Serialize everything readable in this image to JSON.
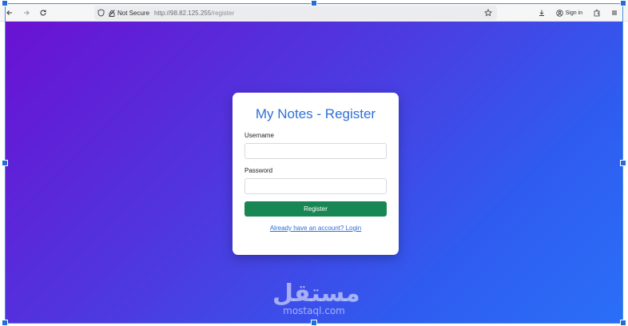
{
  "browser": {
    "url_security": "Not Secure",
    "url_host": "http://98.82.125.255",
    "url_path": "/register",
    "signin_label": "Sign in"
  },
  "page": {
    "title": "My Notes - Register",
    "username_label": "Username",
    "username_value": "",
    "password_label": "Password",
    "password_value": "",
    "submit_label": "Register",
    "login_link": "Already have an account? Login"
  },
  "watermark": {
    "arabic": "مستقل",
    "latin": "mostaql.com"
  },
  "colors": {
    "gradient_start": "#6a12d2",
    "gradient_end": "#2a6ff7",
    "title_blue": "#2f6fd8",
    "button_green": "#198754"
  },
  "icons": [
    "back-arrow-icon",
    "forward-arrow-icon",
    "reload-icon",
    "shield-icon",
    "not-secure-icon",
    "bookmark-star-icon",
    "download-icon",
    "account-icon",
    "extensions-icon",
    "menu-icon"
  ]
}
